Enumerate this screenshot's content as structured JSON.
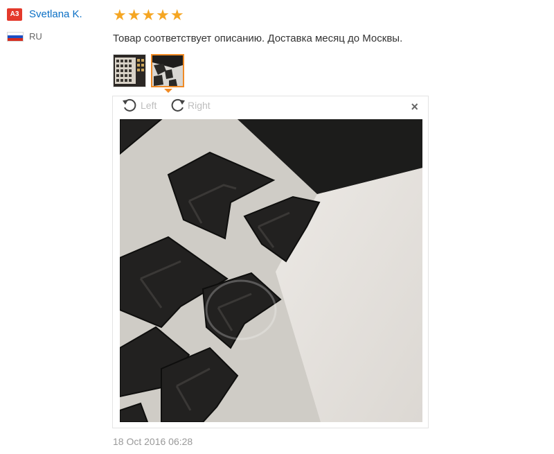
{
  "reviewer": {
    "badge": "A3",
    "name": "Svetlana K.",
    "country": "RU",
    "flag_colors": [
      "#ffffff",
      "#1c4fc4",
      "#d52b1e"
    ]
  },
  "review": {
    "stars": "★★★★★",
    "rating": 5,
    "text": "Товар соответствует описанию. Доставка месяц до Москвы.",
    "date": "18 Oct 2016 06:28"
  },
  "viewer": {
    "rotate_left_label": "Left",
    "rotate_right_label": "Right",
    "close_label": "×"
  },
  "colors": {
    "accent_orange": "#f08a24",
    "link_blue": "#0a6fc5",
    "star": "#f5a623",
    "badge_red": "#e4392b"
  }
}
